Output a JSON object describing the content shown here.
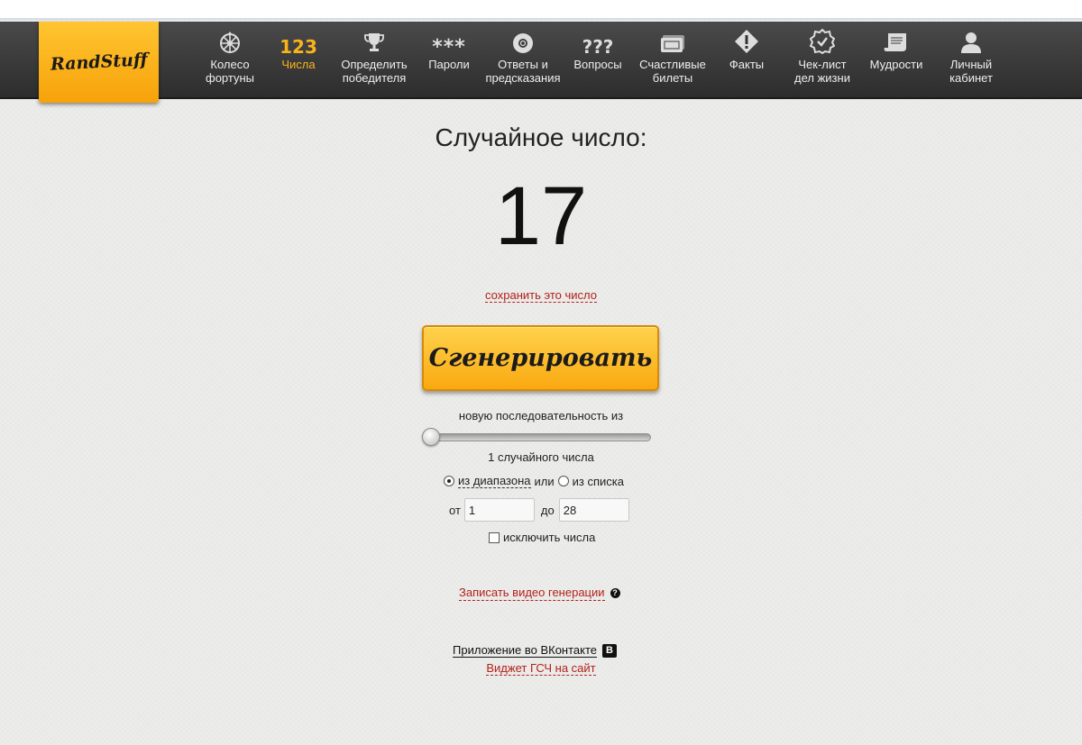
{
  "site": {
    "logo_text": "RandStuff"
  },
  "nav": {
    "items": [
      {
        "label_l1": "Колесо",
        "label_l2": "фортуны",
        "icon": "wheel-icon"
      },
      {
        "label_l1": "Числа",
        "label_l2": "",
        "icon": "numbers-123-icon",
        "glyph": "123",
        "active": true
      },
      {
        "label_l1": "Определить",
        "label_l2": "победителя",
        "icon": "trophy-icon"
      },
      {
        "label_l1": "Пароли",
        "label_l2": "",
        "icon": "password-asterisks-icon",
        "glyph": "***"
      },
      {
        "label_l1": "Ответы и",
        "label_l2": "предсказания",
        "icon": "magic-ball-icon"
      },
      {
        "label_l1": "Вопросы",
        "label_l2": "",
        "icon": "question-marks-icon",
        "glyph": "???"
      },
      {
        "label_l1": "Счастливые",
        "label_l2": "билеты",
        "icon": "tickets-icon"
      },
      {
        "label_l1": "Факты",
        "label_l2": "",
        "icon": "fact-diamond-icon"
      },
      {
        "label_l1": "Чек-лист",
        "label_l2": "дел жизни",
        "icon": "checklist-badge-icon"
      },
      {
        "label_l1": "Мудрости",
        "label_l2": "",
        "icon": "scroll-icon"
      },
      {
        "label_l1": "Личный",
        "label_l2": "кабинет",
        "icon": "user-icon"
      }
    ]
  },
  "main": {
    "title": "Случайное число:",
    "result": "17",
    "save_link": "сохранить это число",
    "generate_button": "Сгенерировать",
    "sequence_label": "новую последовательность из",
    "sequence_value": 1,
    "count_text": "1 случайного числа",
    "mode": {
      "range_label": "из диапазона",
      "or": "или",
      "list_label": "из списка",
      "selected": "range"
    },
    "range": {
      "from_label": "от",
      "from_value": "1",
      "to_label": "до",
      "to_value": "28"
    },
    "exclude_label": "исключить числа",
    "video_link": "Записать видео генерации",
    "help_glyph": "?",
    "vk_link": "Приложение во ВКонтакте",
    "vk_glyph": "B",
    "widget_link": "Виджет ГСЧ на сайт"
  },
  "colors": {
    "accent": "#f9a90f",
    "nav_bg": "#3a3a3a",
    "active_nav": "#f9b41a",
    "link_red": "#b3211b"
  }
}
